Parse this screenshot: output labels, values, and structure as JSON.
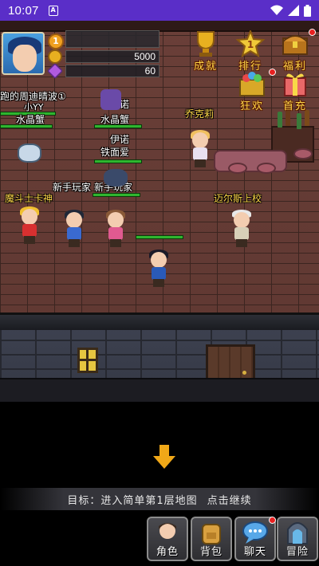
{
  "status_bar": {
    "time": "10:07",
    "sim_badge": "A"
  },
  "player": {
    "level": "1",
    "gold": "5000",
    "gems": "60"
  },
  "top_menu": [
    {
      "label": "成就",
      "icon": "trophy-icon"
    },
    {
      "label": "排行",
      "icon": "star-badge-icon"
    },
    {
      "label": "福利",
      "icon": "treasure-chest-icon"
    },
    {
      "label": "狂欢",
      "icon": "gift-box-icon"
    },
    {
      "label": "首充",
      "icon": "gift-ribbon-icon"
    }
  ],
  "npcs": {
    "scroll_text": "跑的周迪晴波①",
    "xiaoyy": "小YY",
    "shuijing_left": "水晶蟹",
    "yinuo_1": "伊诺",
    "shuijing_right": "水晶蟹",
    "yinuo_2": "伊诺",
    "tiemian": "铁面爱",
    "modou": "魔斗士卡神",
    "newbie_1": "新手玩家",
    "newbie_2": "新手玩家",
    "qiaokeli": "乔克莉",
    "maers": "迈尔斯上校"
  },
  "goal": {
    "label": "目标：",
    "text": "进入简单第1层地图",
    "action": "点击继续"
  },
  "bottom_nav": [
    {
      "label": "角色",
      "icon": "character-icon"
    },
    {
      "label": "背包",
      "icon": "backpack-icon"
    },
    {
      "label": "聊天",
      "icon": "chat-bubble-icon"
    },
    {
      "label": "冒险",
      "icon": "adventure-portal-icon"
    }
  ],
  "colors": {
    "status_bar": "#5a2ec8",
    "menu_text": "#ffd84a",
    "hp": "#2fb52f",
    "notify": "#e82020",
    "arrow": "#f0a818"
  }
}
